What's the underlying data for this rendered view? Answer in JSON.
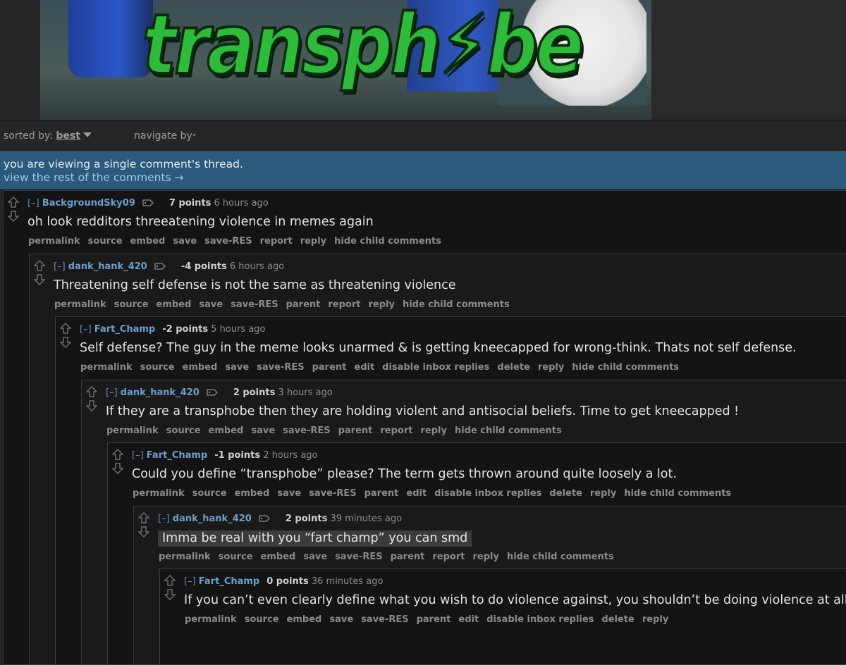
{
  "banner": {
    "meme_text": "transph⚡be"
  },
  "sort": {
    "label": "sorted by:",
    "value": "best",
    "navigate": "navigate by",
    "navigate_icon": "double-chevron-down"
  },
  "notice": {
    "line1": "you are viewing a single comment's thread.",
    "line2": "view the rest of the comments →"
  },
  "colors": {
    "background": "#262626",
    "comment_bg": "#141414",
    "notice_bg": "#2c5a7c",
    "author": "#6a9fc9",
    "link": "#9cc7e6"
  },
  "comments": [
    {
      "expand": "[–]",
      "author": "BackgroundSky09",
      "tag_icon": true,
      "score": "7 points",
      "time": "6 hours ago",
      "body": "oh look redditors threeatening violence in memes again",
      "buttons": [
        "permalink",
        "source",
        "embed",
        "save",
        "save-RES",
        "report",
        "reply",
        "hide child comments"
      ]
    },
    {
      "expand": "[–]",
      "author": "dank_hank_420",
      "tag_icon": true,
      "score": "-4 points",
      "time": "6 hours ago",
      "body": "Threatening self defense is not the same as threatening violence",
      "buttons": [
        "permalink",
        "source",
        "embed",
        "save",
        "save-RES",
        "parent",
        "report",
        "reply",
        "hide child comments"
      ]
    },
    {
      "expand": "[–]",
      "author": "Fart_Champ",
      "tag_icon": false,
      "score": "-2 points",
      "time": "5 hours ago",
      "body": "Self defense? The guy in the meme looks unarmed & is getting kneecapped for wrong-think. Thats not self defense.",
      "buttons": [
        "permalink",
        "source",
        "embed",
        "save",
        "save-RES",
        "parent",
        "edit",
        "disable inbox replies",
        "delete",
        "reply",
        "hide child comments"
      ]
    },
    {
      "expand": "[–]",
      "author": "dank_hank_420",
      "tag_icon": true,
      "score": "2 points",
      "time": "3 hours ago",
      "body": "If they are a transphobe then they are holding violent and antisocial beliefs. Time to get kneecapped !",
      "buttons": [
        "permalink",
        "source",
        "embed",
        "save",
        "save-RES",
        "parent",
        "report",
        "reply",
        "hide child comments"
      ]
    },
    {
      "expand": "[–]",
      "author": "Fart_Champ",
      "tag_icon": false,
      "score": "-1 points",
      "time": "2 hours ago",
      "body": "Could you define “transphobe” please? The term gets thrown around quite loosely a lot.",
      "buttons": [
        "permalink",
        "source",
        "embed",
        "save",
        "save-RES",
        "parent",
        "edit",
        "disable inbox replies",
        "delete",
        "reply",
        "hide child comments"
      ]
    },
    {
      "expand": "[–]",
      "author": "dank_hank_420",
      "tag_icon": true,
      "score": "2 points",
      "time": "39 minutes ago",
      "body": "Imma be real with you “fart champ” you can smd",
      "buttons": [
        "permalink",
        "source",
        "embed",
        "save",
        "save-RES",
        "parent",
        "report",
        "reply",
        "hide child comments"
      ]
    },
    {
      "expand": "[–]",
      "author": "Fart_Champ",
      "tag_icon": false,
      "score": "0 points",
      "time": "36 minutes ago",
      "body": "If you can’t even clearly define what you wish to do violence against, you shouldn’t be doing violence at all.",
      "buttons": [
        "permalink",
        "source",
        "embed",
        "save",
        "save-RES",
        "parent",
        "edit",
        "disable inbox replies",
        "delete",
        "reply"
      ]
    }
  ]
}
